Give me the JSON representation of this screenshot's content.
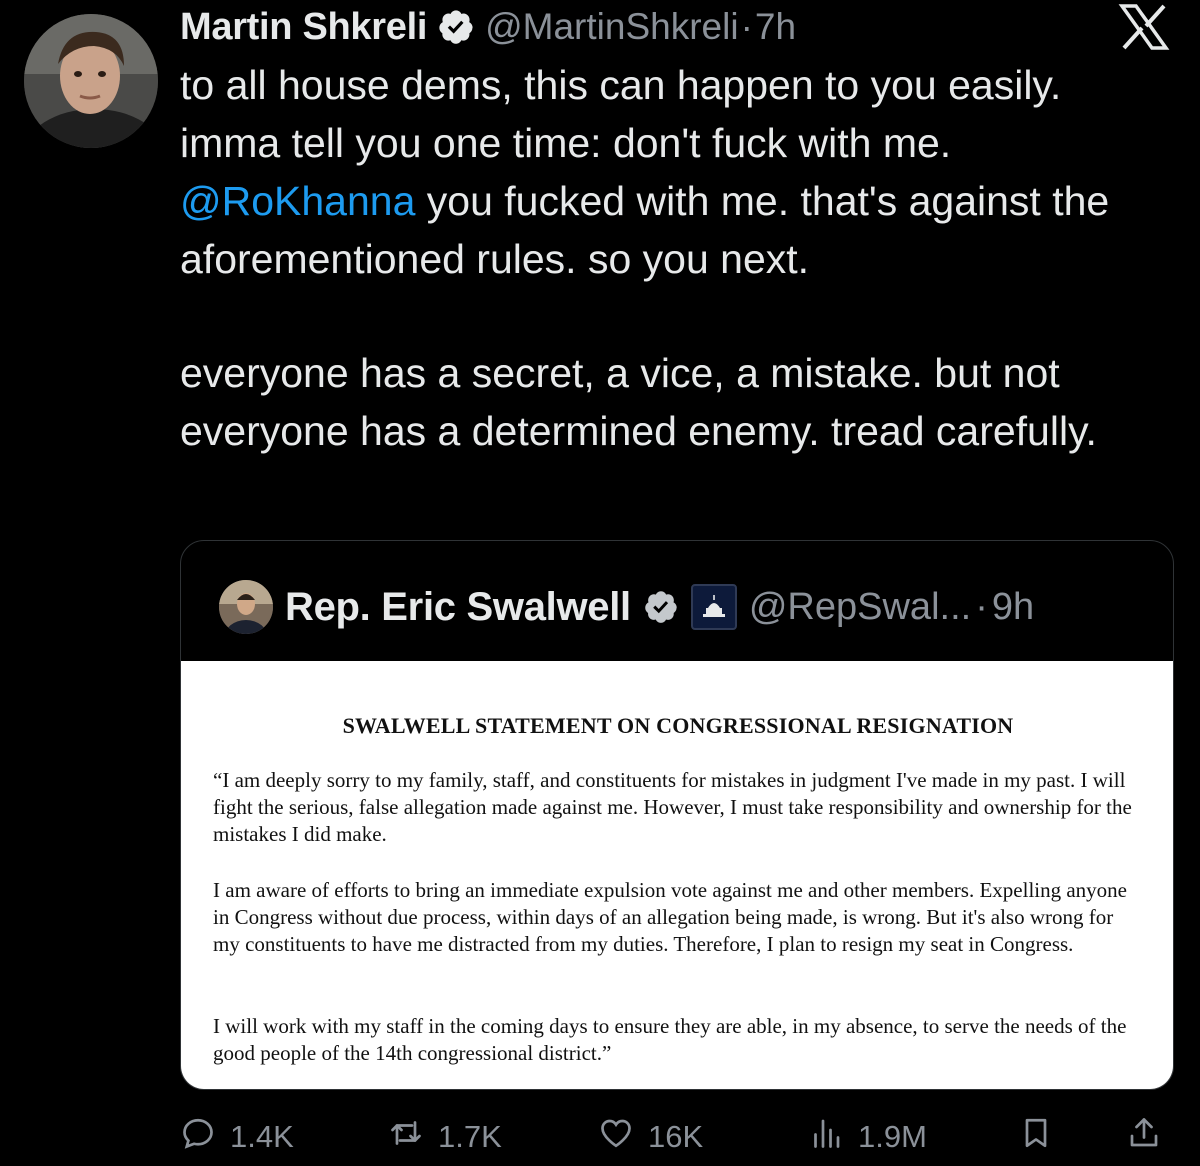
{
  "tweet": {
    "display_name": "Martin Shkreli",
    "handle": "@MartinShkreli",
    "separator": "·",
    "time": "7h",
    "text_part1": "to all house dems, this can happen to you easily. imma tell you one time: don't fuck with me.",
    "mention": "@RoKhanna",
    "text_part2": " you fucked with me. that's against the aforementioned rules. so you next.",
    "text_paragraph2": "everyone has a secret, a vice, a mistake. but not everyone has a determined enemy. tread carefully."
  },
  "quoted_tweet": {
    "display_name": "Rep. Eric Swalwell",
    "handle": "@RepSwal...",
    "separator": "·",
    "time": "9h",
    "document": {
      "title": "SWALWELL STATEMENT ON CONGRESSIONAL RESIGNATION",
      "paragraph1": "“I am deeply sorry to my family, staff, and constituents for mistakes in judgment I've made in my past.  I will fight the serious, false allegation made against me. However, I must take responsibility and ownership for the mistakes I did make.",
      "paragraph2": "I am aware of efforts to bring an immediate expulsion vote against me and other members.  Expelling anyone in Congress without due process, within days of an allegation being made, is wrong.  But it's also wrong for my constituents to have me distracted from my duties.  Therefore, I plan to resign my seat in Congress.",
      "paragraph3": "I will work with my staff in the coming days to ensure they are able, in my absence, to serve the needs of the good people of the 14th congressional district.”"
    }
  },
  "actions": {
    "replies": "1.4K",
    "reposts": "1.7K",
    "likes": "16K",
    "views": "1.9M"
  },
  "icons": {
    "verified": "verified-badge-icon",
    "brand": "x-logo-icon",
    "reply": "reply-icon",
    "repost": "repost-icon",
    "like": "heart-icon",
    "views": "views-icon",
    "bookmark": "bookmark-icon",
    "share": "share-icon",
    "affiliation": "capitol-icon"
  },
  "colors": {
    "background": "#000000",
    "text": "#e7e9ea",
    "muted": "#8b9199",
    "link": "#1d9bf0",
    "verified_badge": "#e7e9ea"
  }
}
